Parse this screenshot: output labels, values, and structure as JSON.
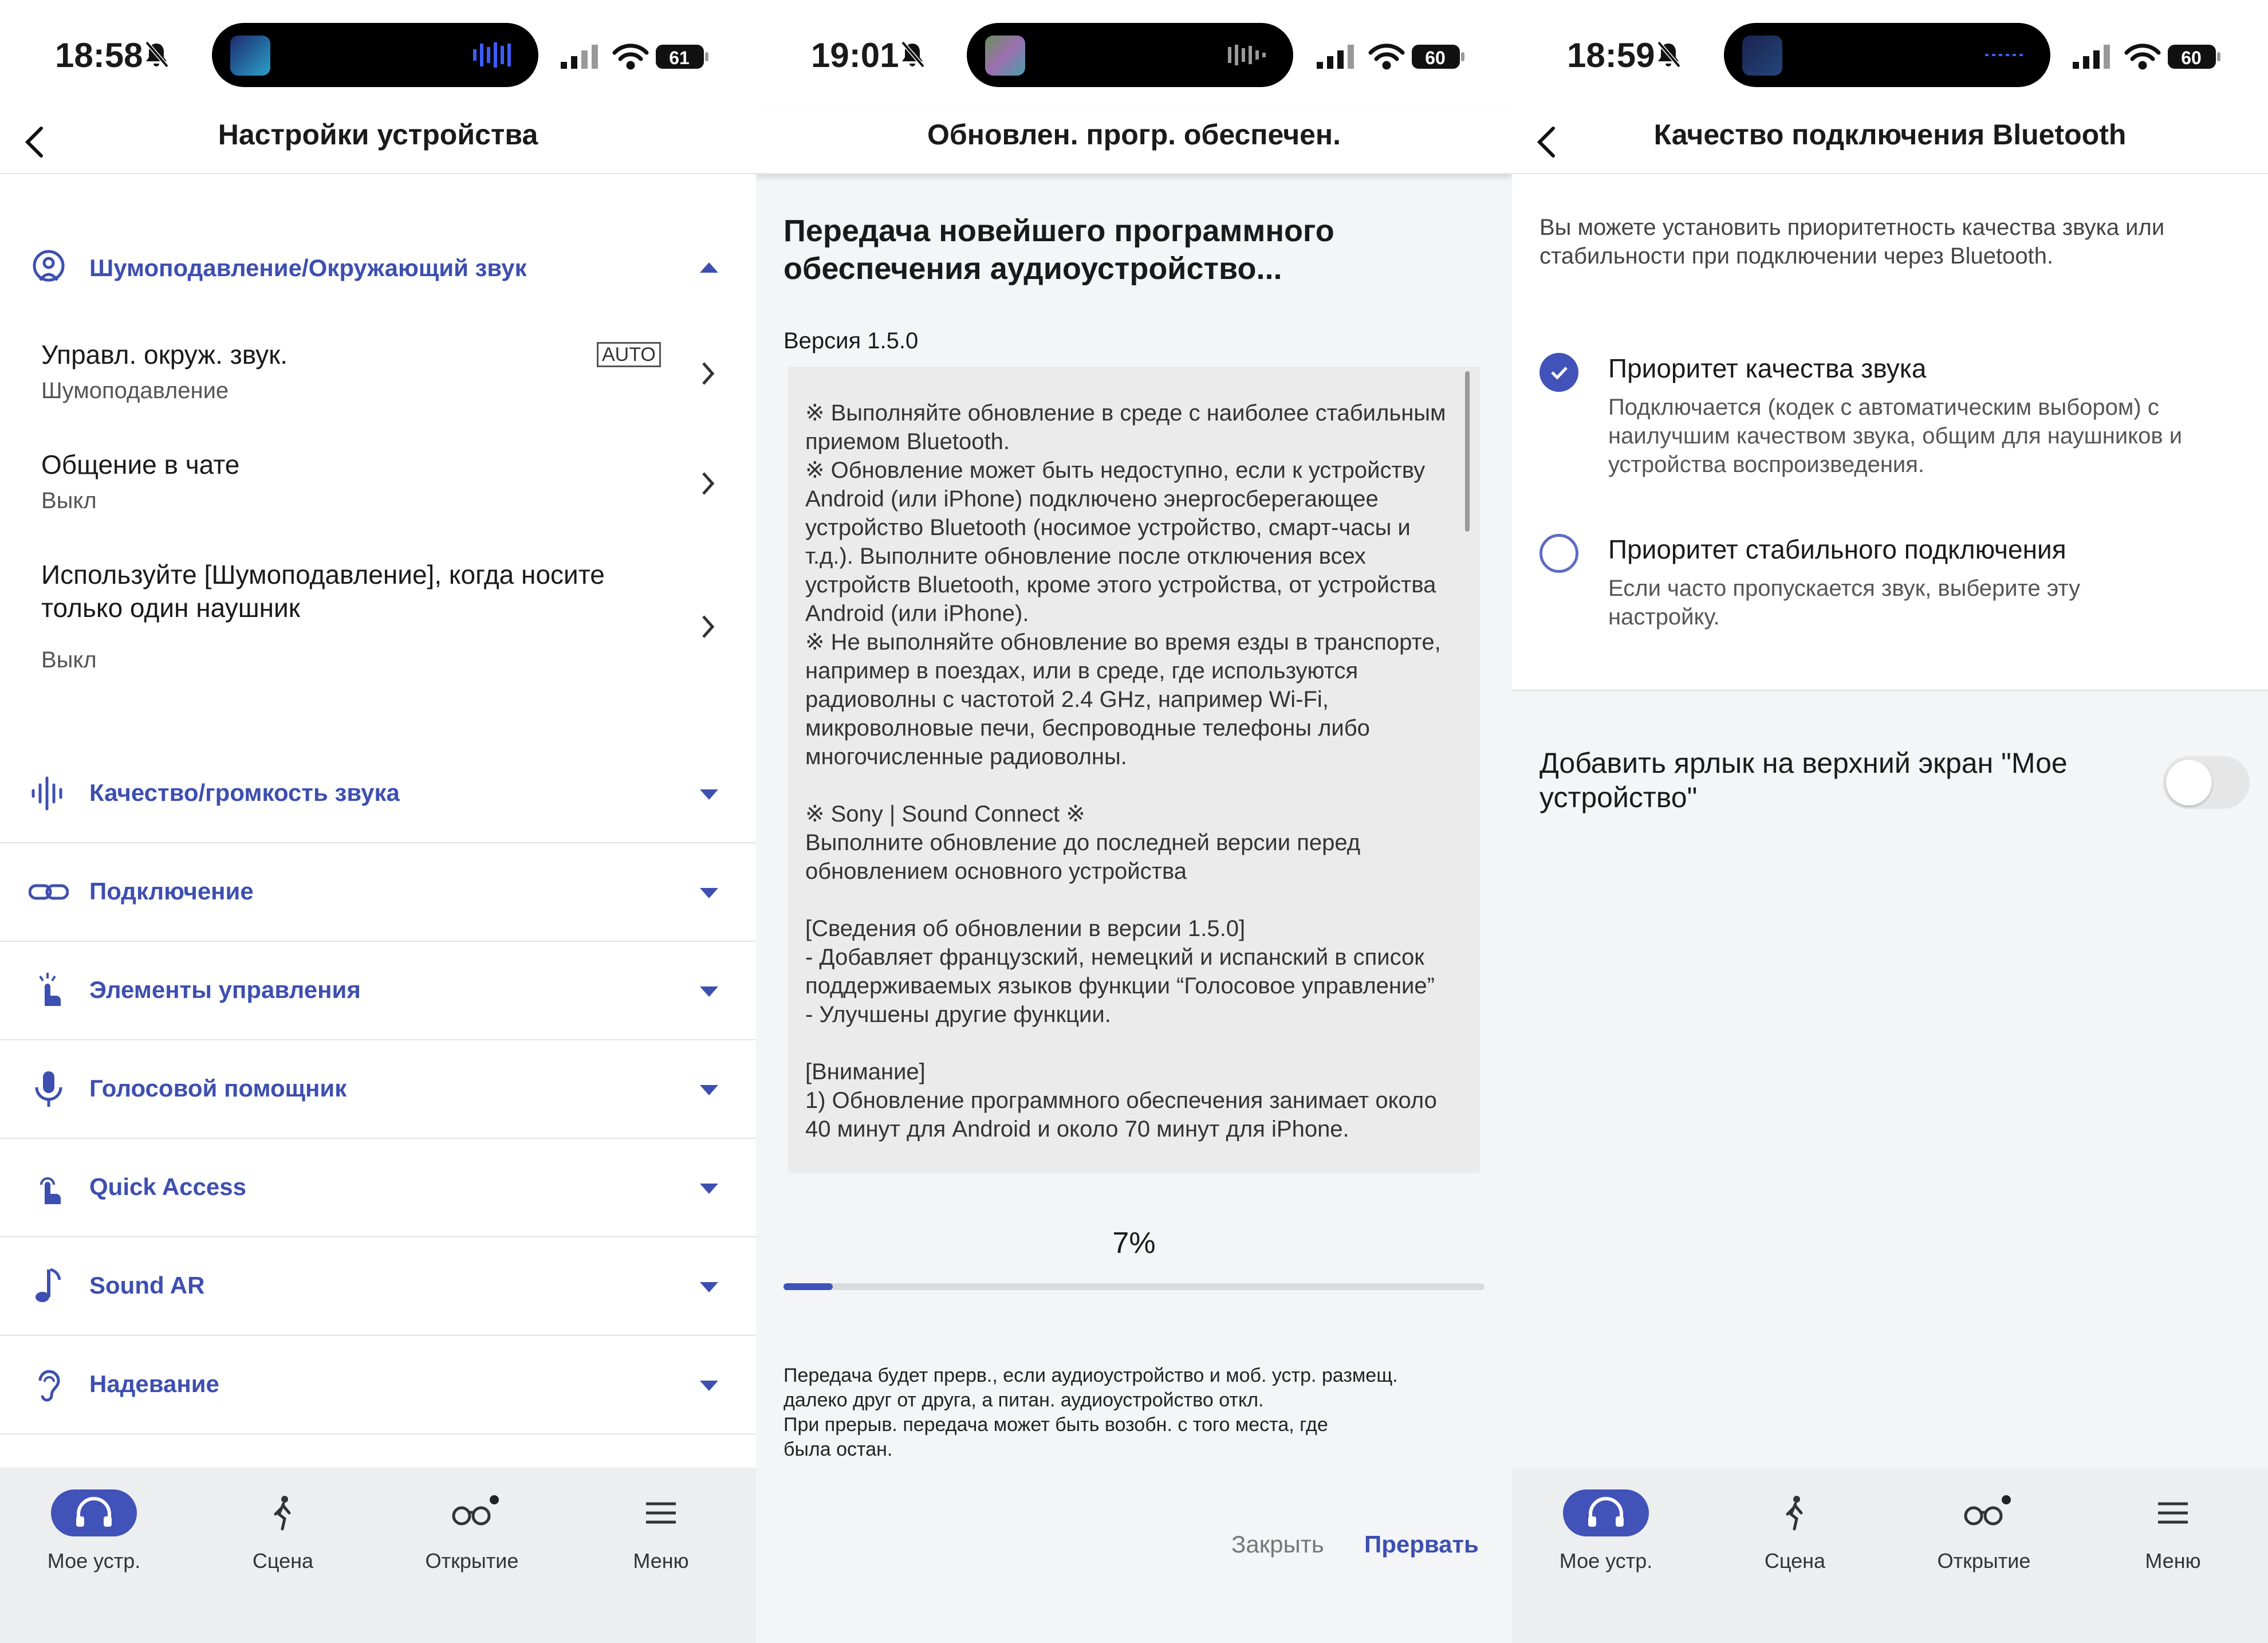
{
  "panel1": {
    "status": {
      "time": "18:58",
      "battery": "61"
    },
    "header": {
      "title": "Настройки устройства"
    },
    "expanded_category": "Шумоподавление/Окружающий звук",
    "auto_badge": "AUTO",
    "rows": [
      {
        "title": "Управл. окруж. звук.",
        "sub": "Шумоподавление"
      },
      {
        "title": "Общение в чате",
        "sub": "Выкл"
      },
      {
        "title": "Используйте [Шумоподавление], когда носите только один наушник",
        "sub": "Выкл"
      }
    ],
    "categories": [
      {
        "label": "Качество/громкость звука",
        "icon": "sound-wave-icon"
      },
      {
        "label": "Подключение",
        "icon": "link-icon"
      },
      {
        "label": "Элементы управления",
        "icon": "touch-icon"
      },
      {
        "label": "Голосовой помощник",
        "icon": "microphone-icon"
      },
      {
        "label": "Quick Access",
        "icon": "quick-touch-icon"
      },
      {
        "label": "Sound AR",
        "icon": "music-note-icon"
      },
      {
        "label": "Надевание",
        "icon": "ear-icon"
      }
    ]
  },
  "panel2": {
    "status": {
      "time": "19:01",
      "battery": "60"
    },
    "header": {
      "title": "Обновлен. прогр. обеспечен."
    },
    "heading": "Передача новейшего программного обеспечения аудиоустройство...",
    "version": "Версия 1.5.0",
    "notes": "※ Выполняйте обновление в среде с наиболее стабильным приемом Bluetooth.\n※ Обновление может быть недоступно, если к устройству Android (или iPhone) подключено энергосберегающее устройство Bluetooth (носимое устройство, смарт-часы и т.д.). Выполните обновление после отключения всех устройств Bluetooth, кроме этого устройства, от устройства Android (или iPhone).\n※ Не выполняйте обновление во время езды в транспорте, например в поездах, или в среде, где используются радиоволны с частотой 2.4 GHz, например Wi-Fi, микроволновые печи, беспроводные телефоны либо многочисленные радиоволны.\n\n※ Sony | Sound Connect ※\nВыполните обновление до последней версии перед обновлением основного устройства\n\n[Сведения об обновлении в версии 1.5.0]\n- Добавляет французский, немецкий и испанский в список поддерживаемых языков функции “Голосовое управление”\n- Улучшены другие функции.\n\n[Внимание]\n1) Обновление программного обеспечения занимает около 40 минут для Android и около 70 минут для iPhone.",
    "progress_text": "7%",
    "progress": 0.07,
    "warning": "Передача будет прерв., если аудиоустройство и моб. устр. размещ.\nдалеко друг от друга, а питан. аудиоустройство откл.\nПри прерыв. передача может быть возобн. с того места, где\nбыла остан.",
    "close_label": "Закрыть",
    "abort_label": "Прервать"
  },
  "panel3": {
    "status": {
      "time": "18:59",
      "battery": "60"
    },
    "header": {
      "title": "Качество подключения Bluetooth"
    },
    "intro": "Вы можете установить приоритетность качества звука или стабильности при подключении через Bluetooth.",
    "options": [
      {
        "title": "Приоритет качества звука",
        "desc": "Подключается (кодек с автоматическим выбором) с наилучшим качеством звука, общим для наушников и устройства воспроизведения.",
        "selected": true
      },
      {
        "title": "Приоритет стабильного подключения",
        "desc": "Если часто пропускается звук, выберите эту настройку.",
        "selected": false
      }
    ],
    "shortcut_label": "Добавить ярлык на верхний экран \"Мое устройство\"",
    "shortcut_on": false
  },
  "nav": [
    "Мое устр.",
    "Сцена",
    "Открытие",
    "Меню"
  ],
  "colors": {
    "accent": "#4152b8",
    "accent_text": "#3d4fb0",
    "background": "#f4f5f7"
  }
}
